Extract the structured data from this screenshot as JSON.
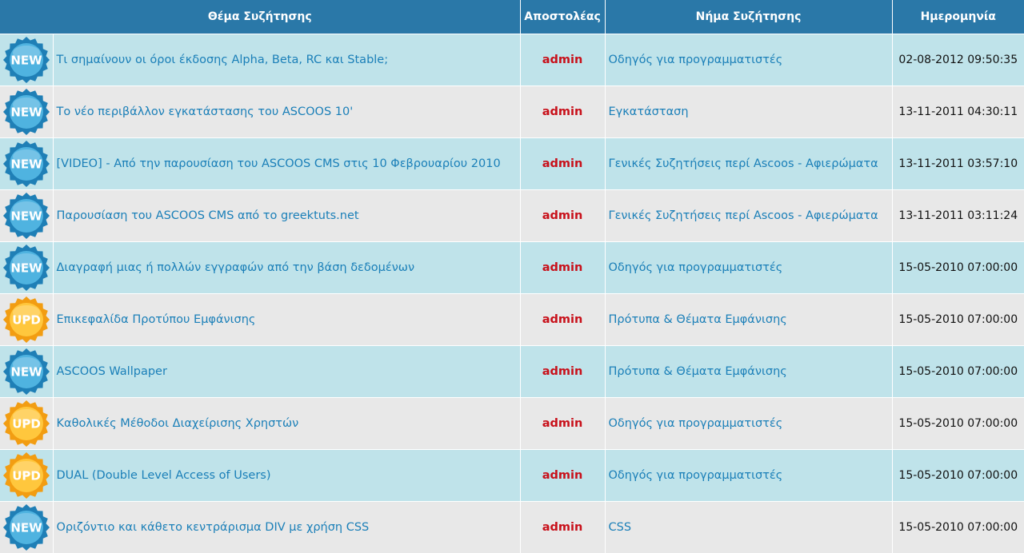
{
  "table": {
    "headers": {
      "topic": "Θέμα Συζήτησης",
      "sender": "Αποστολέας",
      "thread": "Νήμα Συζήτησης",
      "date": "Ημερομηνία"
    },
    "rows": [
      {
        "badge": "NEW",
        "topic": "Τι σημαίνουν οι όροι έκδοσης Alpha, Beta, RC και Stable;",
        "sender": "admin",
        "thread": "Οδηγός για προγραμματιστές",
        "date": "02-08-2012 09:50:35"
      },
      {
        "badge": "NEW",
        "topic": "Το νέο περιβάλλον εγκατάστασης του ASCOOS 10'",
        "sender": "admin",
        "thread": "Εγκατάσταση",
        "date": "13-11-2011 04:30:11"
      },
      {
        "badge": "NEW",
        "topic": "[VIDEO] - Από την παρουσίαση του ASCOOS CMS στις 10 Φεβρουαρίου 2010",
        "sender": "admin",
        "thread": "Γενικές Συζητήσεις περί Ascoos - Αφιερώματα",
        "date": "13-11-2011 03:57:10"
      },
      {
        "badge": "NEW",
        "topic": "Παρουσίαση του ASCOOS CMS από το greektuts.net",
        "sender": "admin",
        "thread": "Γενικές Συζητήσεις περί Ascoos - Αφιερώματα",
        "date": "13-11-2011 03:11:24"
      },
      {
        "badge": "NEW",
        "topic": "Διαγραφή μιας ή πολλών εγγραφών από την βάση δεδομένων",
        "sender": "admin",
        "thread": "Οδηγός για προγραμματιστές",
        "date": "15-05-2010 07:00:00"
      },
      {
        "badge": "UPD",
        "topic": "Επικεφαλίδα Προτύπου Εμφάνισης",
        "sender": "admin",
        "thread": "Πρότυπα & Θέματα Εμφάνισης",
        "date": "15-05-2010 07:00:00"
      },
      {
        "badge": "NEW",
        "topic": "ASCOOS Wallpaper",
        "sender": "admin",
        "thread": "Πρότυπα & Θέματα Εμφάνισης",
        "date": "15-05-2010 07:00:00"
      },
      {
        "badge": "UPD",
        "topic": "Καθολικές Μέθοδοι Διαχείρισης Χρηστών",
        "sender": "admin",
        "thread": "Οδηγός για προγραμματιστές",
        "date": "15-05-2010 07:00:00"
      },
      {
        "badge": "UPD",
        "topic": "DUAL (Double Level Access of Users)",
        "sender": "admin",
        "thread": "Οδηγός για προγραμματιστές",
        "date": "15-05-2010 07:00:00"
      },
      {
        "badge": "NEW",
        "topic": "Οριζόντιο και κάθετο κεντράρισμα DIV με χρήση CSS",
        "sender": "admin",
        "thread": "CSS",
        "date": "15-05-2010 07:00:00"
      }
    ]
  },
  "badge_colors": {
    "NEW": {
      "outer": "#1f7fb6",
      "inner": "#4fb3e0",
      "icon": "new-badge-icon"
    },
    "UPD": {
      "outer": "#f29d12",
      "inner": "#ffc73d",
      "icon": "upd-badge-icon"
    }
  },
  "colors": {
    "header_bg": "#2a78a8",
    "row_odd": "#bfe3ea",
    "row_even": "#e8e8e8",
    "link": "#1a7fb8",
    "sender": "#c8101a"
  }
}
